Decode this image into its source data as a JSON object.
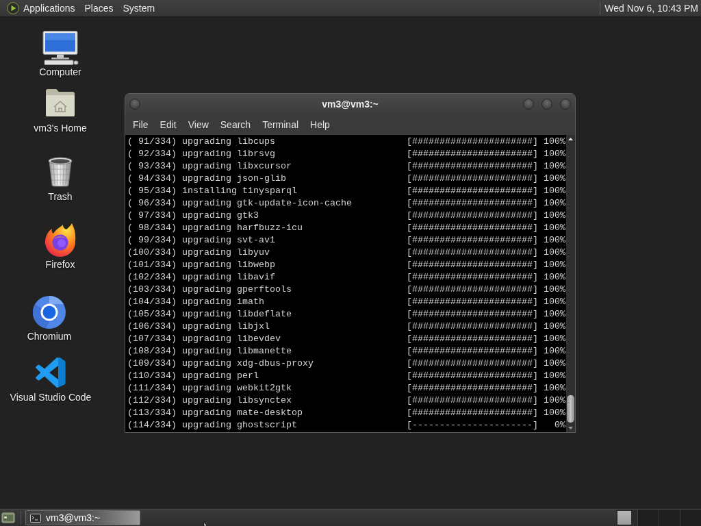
{
  "top_panel": {
    "menus": [
      "Applications",
      "Places",
      "System"
    ],
    "clock": "Wed Nov 6, 10:43 PM"
  },
  "desktop_icons": [
    {
      "label": "Computer",
      "kind": "computer"
    },
    {
      "label": "vm3's Home",
      "kind": "home"
    },
    {
      "label": "Trash",
      "kind": "trash"
    },
    {
      "label": "Firefox",
      "kind": "firefox"
    },
    {
      "label": "Chromium",
      "kind": "chromium"
    },
    {
      "label": "Visual Studio Code",
      "kind": "vscode"
    }
  ],
  "terminal": {
    "title": "vm3@vm3:~",
    "menu": [
      "File",
      "Edit",
      "View",
      "Search",
      "Terminal",
      "Help"
    ],
    "lines": [
      {
        "text": "( 91/334) upgrading libcups",
        "bar": "[######################]",
        "percent": "100%"
      },
      {
        "text": "( 92/334) upgrading librsvg",
        "bar": "[######################]",
        "percent": "100%"
      },
      {
        "text": "( 93/334) upgrading libxcursor",
        "bar": "[######################]",
        "percent": "100%"
      },
      {
        "text": "( 94/334) upgrading json-glib",
        "bar": "[######################]",
        "percent": "100%"
      },
      {
        "text": "( 95/334) installing tinysparql",
        "bar": "[######################]",
        "percent": "100%"
      },
      {
        "text": "( 96/334) upgrading gtk-update-icon-cache",
        "bar": "[######################]",
        "percent": "100%"
      },
      {
        "text": "( 97/334) upgrading gtk3",
        "bar": "[######################]",
        "percent": "100%"
      },
      {
        "text": "( 98/334) upgrading harfbuzz-icu",
        "bar": "[######################]",
        "percent": "100%"
      },
      {
        "text": "( 99/334) upgrading svt-av1",
        "bar": "[######################]",
        "percent": "100%"
      },
      {
        "text": "(100/334) upgrading libyuv",
        "bar": "[######################]",
        "percent": "100%"
      },
      {
        "text": "(101/334) upgrading libwebp",
        "bar": "[######################]",
        "percent": "100%"
      },
      {
        "text": "(102/334) upgrading libavif",
        "bar": "[######################]",
        "percent": "100%"
      },
      {
        "text": "(103/334) upgrading gperftools",
        "bar": "[######################]",
        "percent": "100%"
      },
      {
        "text": "(104/334) upgrading imath",
        "bar": "[######################]",
        "percent": "100%"
      },
      {
        "text": "(105/334) upgrading libdeflate",
        "bar": "[######################]",
        "percent": "100%"
      },
      {
        "text": "(106/334) upgrading libjxl",
        "bar": "[######################]",
        "percent": "100%"
      },
      {
        "text": "(107/334) upgrading libevdev",
        "bar": "[######################]",
        "percent": "100%"
      },
      {
        "text": "(108/334) upgrading libmanette",
        "bar": "[######################]",
        "percent": "100%"
      },
      {
        "text": "(109/334) upgrading xdg-dbus-proxy",
        "bar": "[######################]",
        "percent": "100%"
      },
      {
        "text": "(110/334) upgrading perl",
        "bar": "[######################]",
        "percent": "100%"
      },
      {
        "text": "(111/334) upgrading webkit2gtk",
        "bar": "[######################]",
        "percent": "100%"
      },
      {
        "text": "(112/334) upgrading libsynctex",
        "bar": "[######################]",
        "percent": "100%"
      },
      {
        "text": "(113/334) upgrading mate-desktop",
        "bar": "[######################]",
        "percent": "100%"
      },
      {
        "text": "(114/334) upgrading ghostscript",
        "bar": "[----------------------]",
        "percent": "0%"
      }
    ]
  },
  "bottom_panel": {
    "tasks": [
      {
        "label": "vm3@vm3:~",
        "selected": true
      }
    ],
    "workspaces": [
      {
        "selected": true
      },
      {
        "selected": false
      },
      {
        "selected": false
      },
      {
        "selected": false
      }
    ]
  }
}
